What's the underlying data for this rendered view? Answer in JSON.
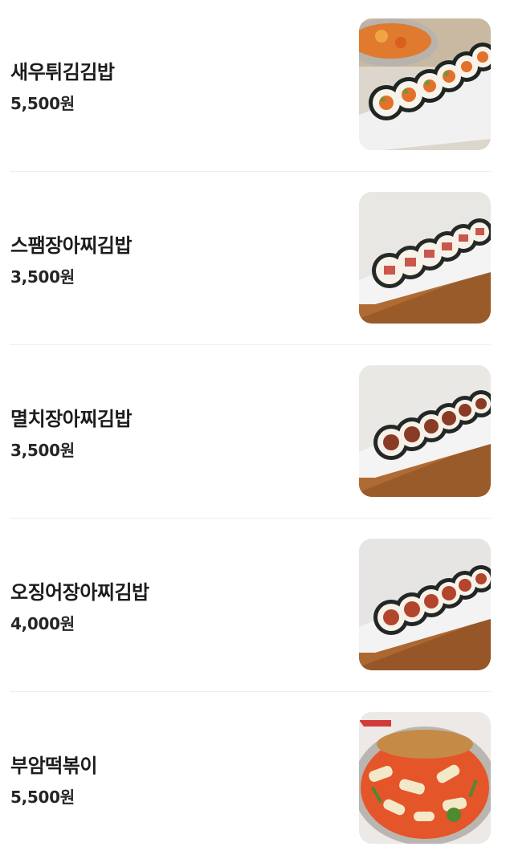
{
  "menu": {
    "items": [
      {
        "name": "새우튀김김밥",
        "price": "5,500원",
        "photo_icon": "kimbap-shrimp-photo"
      },
      {
        "name": "스팸장아찌김밥",
        "price": "3,500원",
        "photo_icon": "kimbap-spam-photo"
      },
      {
        "name": "멸치장아찌김밥",
        "price": "3,500원",
        "photo_icon": "kimbap-anchovy-photo"
      },
      {
        "name": "오징어장아찌김밥",
        "price": "4,000원",
        "photo_icon": "kimbap-squid-photo"
      },
      {
        "name": "부암떡볶이",
        "price": "5,500원",
        "photo_icon": "tteokbokki-photo"
      }
    ]
  },
  "colors": {
    "text": "#1c1c1c",
    "divider": "#eeeeee",
    "background": "#ffffff"
  }
}
